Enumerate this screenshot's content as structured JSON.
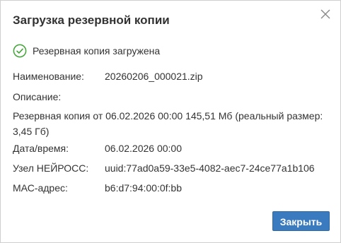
{
  "dialog": {
    "title": "Загрузка резервной копии",
    "status_text": "Резервная копия загружена",
    "fields": {
      "name_label": "Наименование:",
      "name_value": "20260206_000021.zip",
      "description_label": "Описание:",
      "description_value": "Резервная копия от 06.02.2026 00:00 145,51 Мб (реальный размер: 3,45 Гб)",
      "datetime_label": "Дата/время:",
      "datetime_value": "06.02.2026 00:00",
      "node_label": "Узел НЕЙРОСС:",
      "node_value": "uuid:77ad0a59-33e5-4082-aec7-24ce77a1b106",
      "mac_label": "МАС-адрес:",
      "mac_value": "b6:d7:94:00:0f:bb"
    },
    "close_button_label": "Закрыть"
  },
  "icons": {
    "close": "close-icon",
    "status": "check-circle-icon"
  },
  "colors": {
    "success": "#3fa535",
    "primary_button": "#3a7bbf",
    "text": "#333333"
  }
}
